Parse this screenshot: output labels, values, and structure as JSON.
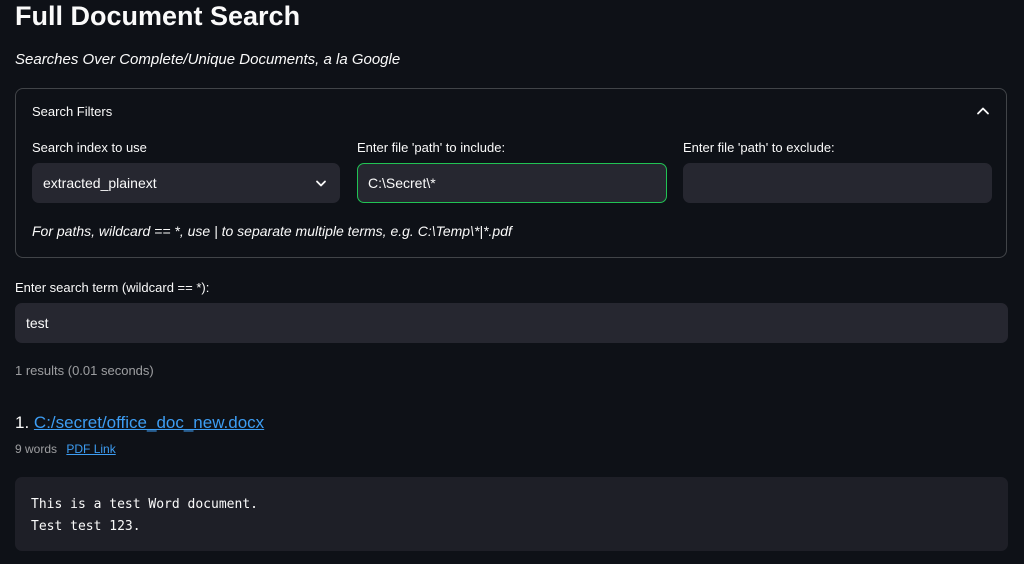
{
  "page": {
    "title": "Full Document Search",
    "subtitle": "Searches Over Complete/Unique Documents, a la Google"
  },
  "filters": {
    "expander_title": "Search Filters",
    "index_label": "Search index to use",
    "index_value": "extracted_plainext",
    "include_label": "Enter file 'path' to include:",
    "include_value": "C:\\Secret\\*",
    "exclude_label": "Enter file 'path' to exclude:",
    "exclude_value": "",
    "hint": "For paths, wildcard == *, use | to separate multiple terms, e.g. C:\\Temp\\*|*.pdf"
  },
  "search": {
    "label": "Enter search term (wildcard == *):",
    "value": "test"
  },
  "results": {
    "summary": "1 results (0.01 seconds)",
    "items": [
      {
        "number": "1.",
        "path": "C:/secret/office_doc_new.docx",
        "words": "9 words",
        "pdf_link": "PDF Link",
        "content": "This is a test Word document.\nTest test 123."
      }
    ]
  },
  "icons": {
    "expander_toggle": "chevron-up-icon",
    "select_toggle": "chevron-down-icon"
  },
  "colors": {
    "background": "#0e1117",
    "input_bg": "#262730",
    "focus_border": "#21c354",
    "link": "#3d9df3"
  }
}
